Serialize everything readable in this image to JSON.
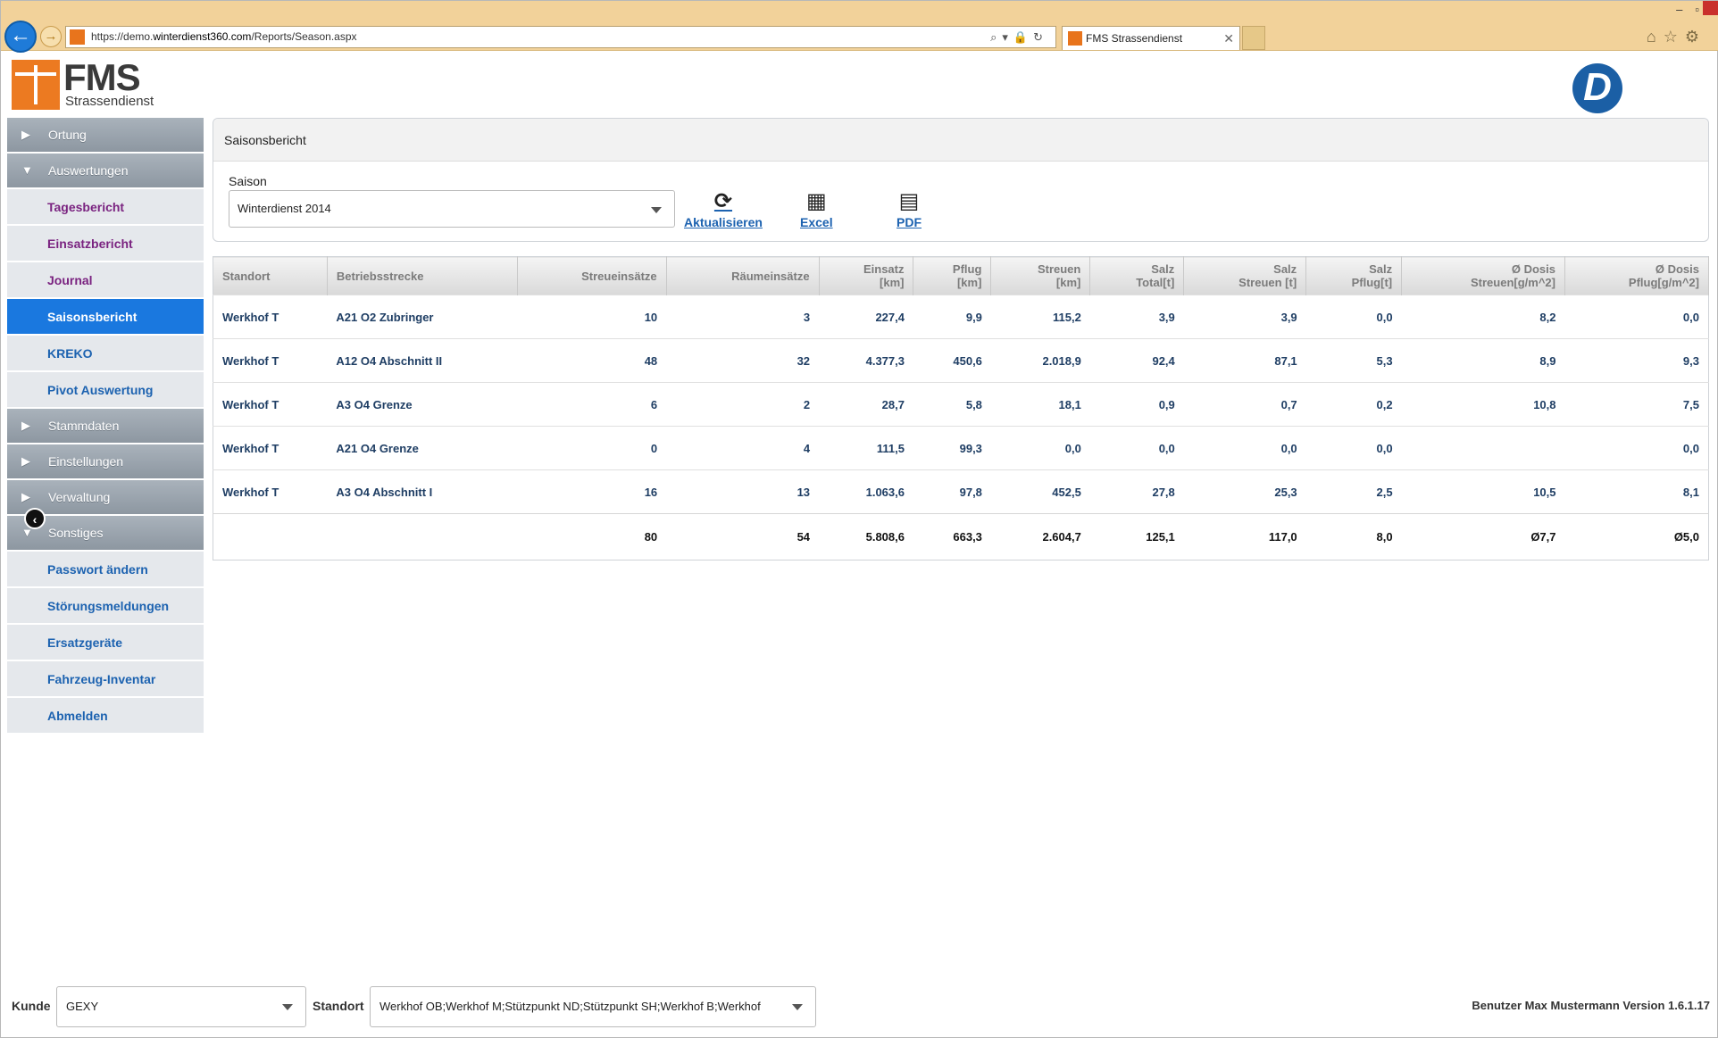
{
  "browser": {
    "url_prefix": "https://demo.",
    "url_host": "winterdienst360.com",
    "url_path": "/Reports/Season.aspx",
    "tab_title": "FMS Strassendienst",
    "address_tools": "⌕▾🔒↻"
  },
  "header": {
    "logo_text": "FMS",
    "logo_sub": "Strassendienst",
    "brand_mark": "D"
  },
  "sidebar": {
    "groups": {
      "ortung": "Ortung",
      "auswertungen": "Auswertungen",
      "stammdaten": "Stammdaten",
      "einstellungen": "Einstellungen",
      "verwaltung": "Verwaltung",
      "sonstiges": "Sonstiges"
    },
    "auswertungen_items": [
      "Tagesbericht",
      "Einsatzbericht",
      "Journal",
      "Saisonsbericht",
      "KREKO",
      "Pivot Auswertung"
    ],
    "sonstiges_items": [
      "Passwort ändern",
      "Störungsmeldungen",
      "Ersatzgeräte",
      "Fahrzeug-Inventar",
      "Abmelden"
    ]
  },
  "report": {
    "title": "Saisonsbericht",
    "saison_label": "Saison",
    "saison_value": "Winterdienst 2014",
    "actions": {
      "refresh": "Aktualisieren",
      "excel": "Excel",
      "pdf": "PDF"
    }
  },
  "table": {
    "headers": [
      [
        "Standort",
        ""
      ],
      [
        "Betriebsstrecke",
        ""
      ],
      [
        "Streueinsätze",
        ""
      ],
      [
        "Räumeinsätze",
        ""
      ],
      [
        "Einsatz",
        "[km]"
      ],
      [
        "Pflug",
        "[km]"
      ],
      [
        "Streuen",
        "[km]"
      ],
      [
        "Salz",
        "Total[t]"
      ],
      [
        "Salz",
        "Streuen [t]"
      ],
      [
        "Salz",
        "Pflug[t]"
      ],
      [
        "Ø Dosis",
        "Streuen[g/m^2]"
      ],
      [
        "Ø Dosis",
        "Pflug[g/m^2]"
      ]
    ],
    "rows": [
      [
        "Werkhof T",
        "A21 O2 Zubringer",
        "10",
        "3",
        "227,4",
        "9,9",
        "115,2",
        "3,9",
        "3,9",
        "0,0",
        "8,2",
        "0,0"
      ],
      [
        "Werkhof T",
        "A12 O4 Abschnitt II",
        "48",
        "32",
        "4.377,3",
        "450,6",
        "2.018,9",
        "92,4",
        "87,1",
        "5,3",
        "8,9",
        "9,3"
      ],
      [
        "Werkhof T",
        "A3 O4 Grenze",
        "6",
        "2",
        "28,7",
        "5,8",
        "18,1",
        "0,9",
        "0,7",
        "0,2",
        "10,8",
        "7,5"
      ],
      [
        "Werkhof T",
        "A21 O4 Grenze",
        "0",
        "4",
        "111,5",
        "99,3",
        "0,0",
        "0,0",
        "0,0",
        "0,0",
        "",
        "0,0"
      ],
      [
        "Werkhof T",
        "A3 O4 Abschnitt I",
        "16",
        "13",
        "1.063,6",
        "97,8",
        "452,5",
        "27,8",
        "25,3",
        "2,5",
        "10,5",
        "8,1"
      ]
    ],
    "totals": [
      "",
      "",
      "80",
      "54",
      "5.808,6",
      "663,3",
      "2.604,7",
      "125,1",
      "117,0",
      "8,0",
      "Ø7,7",
      "Ø5,0"
    ]
  },
  "footer": {
    "kunde_label": "Kunde",
    "kunde_value": "GEXY",
    "standort_label": "Standort",
    "standort_value": "Werkhof OB;Werkhof M;Stützpunkt ND;Stützpunkt SH;Werkhof B;Werkhof",
    "user_info": "Benutzer Max Mustermann  Version 1.6.1.17"
  },
  "colors": {
    "accent": "#1a78df",
    "link": "#1c62b0",
    "visited": "#7a2380",
    "brand_orange": "#ec7a21",
    "chrome_bar": "#f2d29a"
  }
}
